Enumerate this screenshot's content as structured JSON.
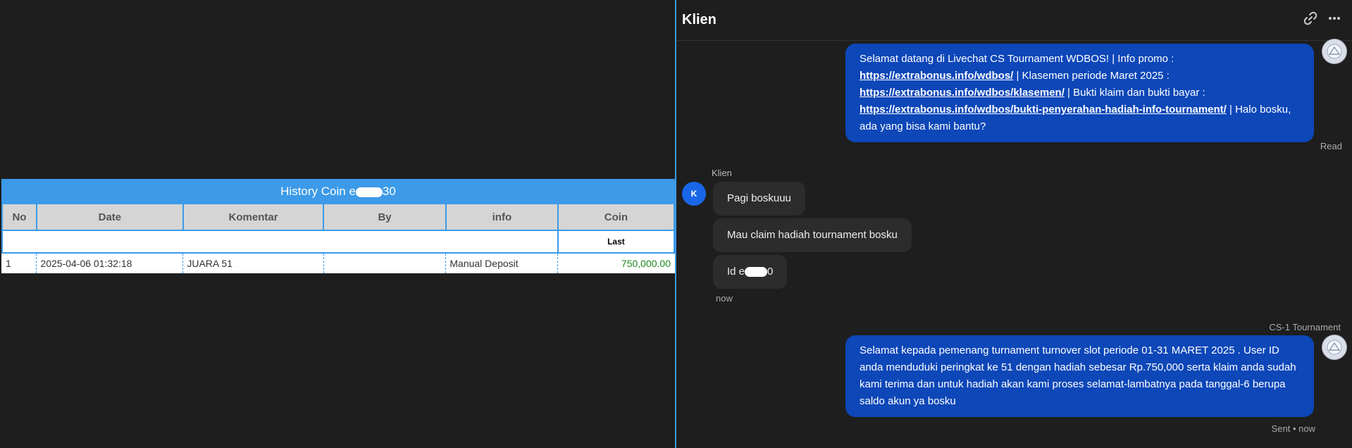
{
  "history": {
    "title_prefix": "History Coin e",
    "title_suffix": "30",
    "columns": [
      "No",
      "Date",
      "Komentar",
      "By",
      "info",
      "Coin"
    ],
    "sub_header": "Last",
    "rows": [
      {
        "no": "1",
        "date": "2025-04-06 01:32:18",
        "komentar": "JUARA 51",
        "by": "",
        "info": "Manual Deposit",
        "coin": "750,000.00"
      }
    ]
  },
  "chat": {
    "title": "Klien",
    "link_icon": "link-icon",
    "more_icon": "more-icon",
    "msg1": {
      "t1": "Selamat datang di Livechat CS Tournament WDBOS! | Info promo : ",
      "l1": "https://extrabonus.info/wdbos/",
      "t2": " | Klasemen periode Maret 2025 : ",
      "l2": "https://extrabonus.info/wdbos/klasemen/",
      "t3": " | Bukti klaim dan bukti bayar : ",
      "l3": "https://extrabonus.info/wdbos/bukti-penyerahan-hadiah-info-tournament/",
      "t4": " | Halo bosku, ada yang bisa kami bantu?",
      "status": "Read"
    },
    "client_name": "Klien",
    "client_initial": "K",
    "client_msgs": [
      "Pagi boskuuu",
      "Mau claim hadiah tournament bosku"
    ],
    "client_id_prefix": "Id e",
    "client_id_suffix": "0",
    "client_time": "now",
    "agent_name": "CS-1 Tournament",
    "msg2": "Selamat kepada pemenang turnament turnover slot periode 01-31 MARET 2025 . User ID anda menduduki peringkat ke 51 dengan hadiah sebesar Rp.750,000 serta klaim anda sudah kami terima dan untuk hadiah akan kami proses selamat-lambatnya pada tanggal-6 berupa saldo akun ya bosku",
    "msg2_status": "Sent • now"
  }
}
